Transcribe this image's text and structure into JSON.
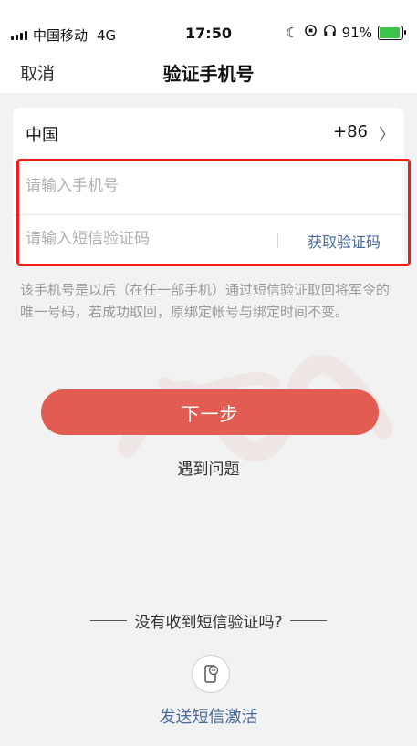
{
  "status_bar": {
    "carrier": "中国移动",
    "network": "4G",
    "time": "17:50",
    "battery_percent": "91%",
    "battery_level": 0.91,
    "icons": [
      "moon-icon",
      "orientation-lock-icon",
      "headphones-icon",
      "battery-charging-icon"
    ]
  },
  "header": {
    "cancel_label": "取消",
    "title": "验证手机号"
  },
  "form": {
    "country_name": "中国",
    "country_code": "+86",
    "phone_placeholder": "请输入手机号",
    "code_placeholder": "请输入短信验证码",
    "get_code_label": "获取验证码"
  },
  "hint": "该手机号是以后（在任一部手机）通过短信验证取回将军令的唯一号码，若成功取回，原绑定帐号与绑定时间不变。",
  "actions": {
    "next_label": "下一步",
    "problem_label": "遇到问题"
  },
  "footer": {
    "no_code_text": "没有收到短信验证吗?",
    "send_sms_label": "发送短信激活"
  },
  "colors": {
    "accent": "#e25c51",
    "link": "#4a6b98",
    "highlight": "#f01d1d",
    "battery": "#3cc24d"
  }
}
